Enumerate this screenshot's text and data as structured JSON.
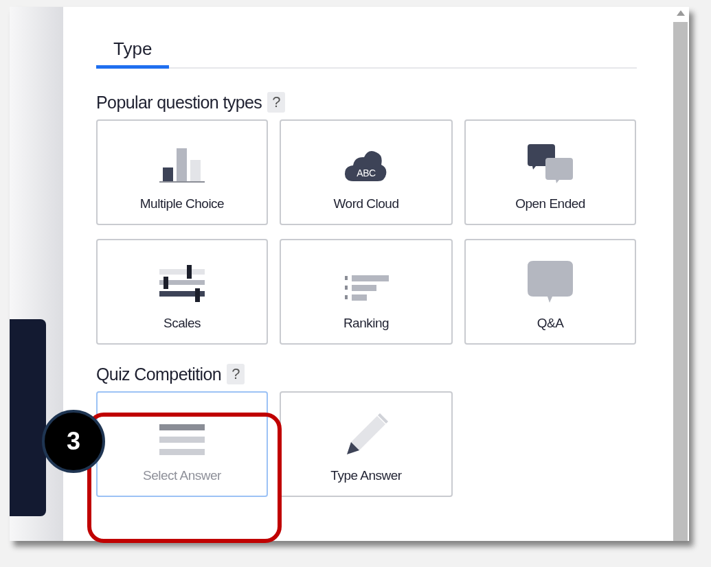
{
  "tabs": [
    {
      "label": "Type",
      "selected": true
    }
  ],
  "sections": [
    {
      "title": "Popular question types",
      "help": "?",
      "cards": [
        {
          "label": "Multiple Choice",
          "kind": "bars",
          "selected": false,
          "disabled": false
        },
        {
          "label": "Word Cloud",
          "kind": "cloud",
          "icon_text": "ABC",
          "selected": false,
          "disabled": false
        },
        {
          "label": "Open Ended",
          "kind": "bubbles",
          "selected": false,
          "disabled": false
        },
        {
          "label": "Scales",
          "kind": "sliders",
          "selected": false,
          "disabled": false
        },
        {
          "label": "Ranking",
          "kind": "ranking",
          "selected": false,
          "disabled": false
        },
        {
          "label": "Q&A",
          "kind": "speech",
          "selected": false,
          "disabled": false
        }
      ]
    },
    {
      "title": "Quiz Competition",
      "help": "?",
      "cards": [
        {
          "label": "Select Answer",
          "kind": "lines",
          "selected": true,
          "disabled": true
        },
        {
          "label": "Type Answer",
          "kind": "pencil",
          "selected": false,
          "disabled": false
        }
      ]
    }
  ],
  "annotation": {
    "number": "3"
  }
}
